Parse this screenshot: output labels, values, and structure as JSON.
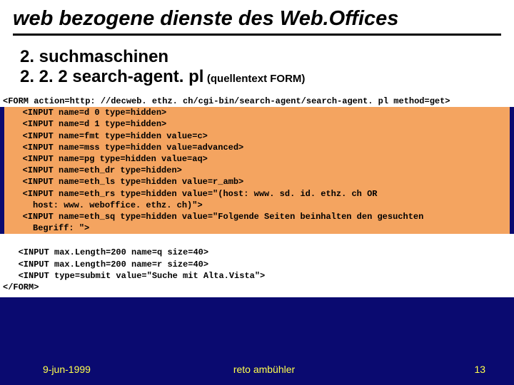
{
  "title": "web bezogene dienste des Web.Offices",
  "sub1": "2. suchmaschinen",
  "sub2": "2. 2. 2   search-agent. pl",
  "sub2_note": "(quellentext FORM)",
  "code": {
    "line_form": "<FORM action=http: //decweb. ethz. ch/cgi-bin/search-agent/search-agent. pl method=get>",
    "line_d0": "   <INPUT name=d 0 type=hidden>",
    "line_d1": "   <INPUT name=d 1 type=hidden>",
    "line_fmt": "   <INPUT name=fmt type=hidden value=c>",
    "line_mss": "   <INPUT name=mss type=hidden value=advanced>",
    "line_pg": "   <INPUT name=pg type=hidden value=aq>",
    "line_dr": "   <INPUT name=eth_dr type=hidden>",
    "line_ls": "   <INPUT name=eth_ls type=hidden value=r_amb>",
    "line_rs": "   <INPUT name=eth_rs type=hidden value=\"(host: www. sd. id. ethz. ch OR",
    "line_rs2": "     host: www. weboffice. ethz. ch)\">",
    "line_sq": "   <INPUT name=eth_sq type=hidden value=\"Folgende Seiten beinhalten den gesuchten",
    "line_sq2": "     Begriff: \">",
    "line_q": "   <INPUT max.Length=200 name=q size=40>",
    "line_r": "   <INPUT max.Length=200 name=r size=40>",
    "line_sub": "   <INPUT type=submit value=\"Suche mit Alta.Vista\">",
    "line_end": "</FORM>"
  },
  "footer": {
    "date": "9-jun-1999",
    "author": "reto ambühler",
    "page": "13"
  }
}
